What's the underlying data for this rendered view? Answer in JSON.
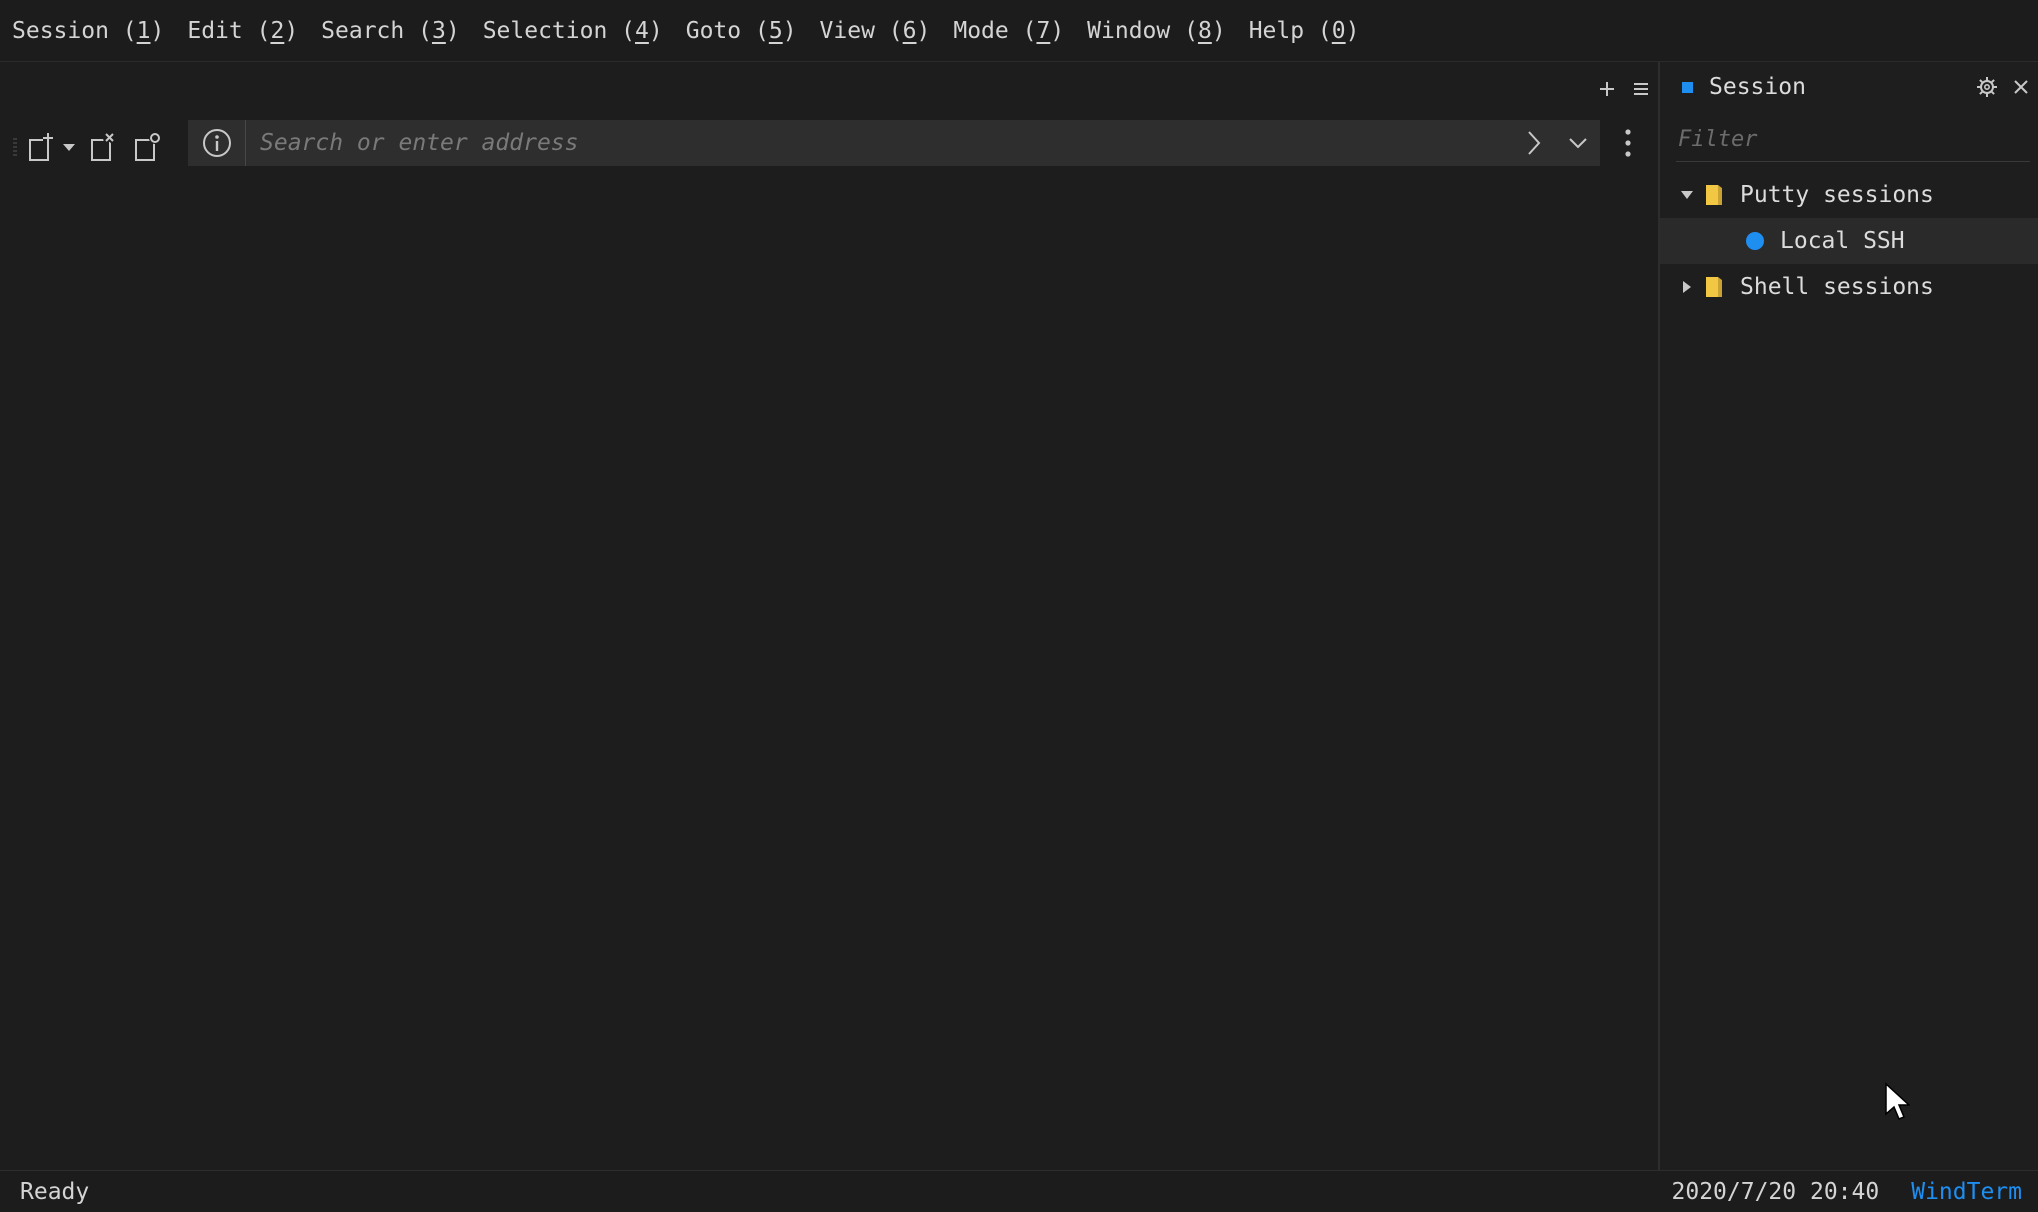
{
  "menu": {
    "items": [
      {
        "label": "Session",
        "key": "1"
      },
      {
        "label": "Edit",
        "key": "2"
      },
      {
        "label": "Search",
        "key": "3"
      },
      {
        "label": "Selection",
        "key": "4"
      },
      {
        "label": "Goto",
        "key": "5"
      },
      {
        "label": "View",
        "key": "6"
      },
      {
        "label": "Mode",
        "key": "7"
      },
      {
        "label": "Window",
        "key": "8"
      },
      {
        "label": "Help",
        "key": "0"
      }
    ]
  },
  "toolbar": {
    "address_placeholder": "Search or enter address",
    "address_value": "",
    "icons": [
      "new-session-icon",
      "dropdown-arrow-icon",
      "close-session-icon",
      "duplicate-session-icon",
      "info-icon",
      "go-arrow-icon",
      "chevron-down-icon",
      "more-vertical-icon"
    ]
  },
  "pane_actions": {
    "icons": [
      "plus-icon",
      "hamburger-menu-icon"
    ]
  },
  "session_panel": {
    "title": "Session",
    "filter_placeholder": "Filter",
    "tree": [
      {
        "label": "Putty sessions",
        "expanded": true,
        "children": [
          {
            "label": "Local SSH",
            "selected": true
          }
        ]
      },
      {
        "label": "Shell sessions",
        "expanded": false,
        "children": []
      }
    ]
  },
  "status": {
    "text": "Ready",
    "datetime": "2020/7/20 20:40",
    "brand": "WindTerm"
  },
  "colors": {
    "accent": "#1f8ef1",
    "background": "#1d1d1d",
    "folder": "#f2c744"
  }
}
